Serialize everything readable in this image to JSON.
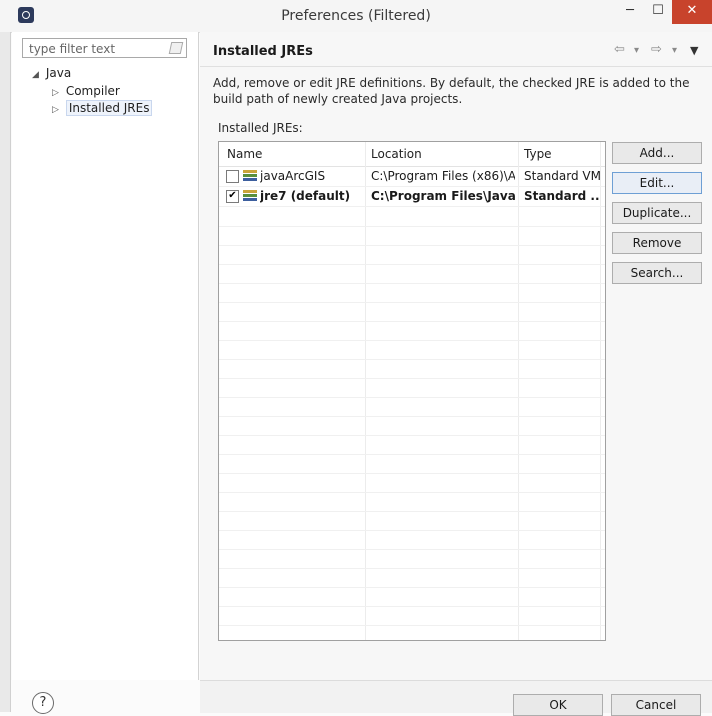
{
  "window": {
    "title": "Preferences (Filtered)",
    "minimize_glyph": "─",
    "maximize_glyph": "☐",
    "close_glyph": "✕"
  },
  "filter": {
    "placeholder": "type filter text"
  },
  "tree": {
    "items": [
      {
        "label": "Java",
        "expander": "◢"
      },
      {
        "label": "Compiler",
        "expander": "▷"
      },
      {
        "label": "Installed JREs",
        "expander": "▷"
      }
    ]
  },
  "page": {
    "title": "Installed JREs",
    "back_glyph": "⇦",
    "forward_glyph": "⇨",
    "dropdown_glyph": "▾",
    "menu_glyph": "▼",
    "description": "Add, remove or edit JRE definitions. By default, the checked JRE is added to the build path of newly created Java projects.",
    "group_label": "Installed JREs:"
  },
  "table": {
    "columns": [
      "Name",
      "Location",
      "Type"
    ],
    "rows": [
      {
        "checked": false,
        "check_glyph": "",
        "name": "javaArcGIS",
        "location": "C:\\Program Files (x86)\\A...",
        "type": "Standard VM",
        "bold": false
      },
      {
        "checked": true,
        "check_glyph": "✔",
        "name": "jre7 (default)",
        "location": "C:\\Program Files\\Java\\j...",
        "type": "Standard ...",
        "bold": true
      }
    ]
  },
  "buttons": {
    "add": "Add...",
    "edit": "Edit...",
    "duplicate": "Duplicate...",
    "remove": "Remove",
    "search": "Search..."
  },
  "footer": {
    "help_glyph": "?",
    "ok": "OK",
    "cancel": "Cancel"
  },
  "colors": {
    "close_button": "#c8432c",
    "selection": "#eef3fb"
  }
}
